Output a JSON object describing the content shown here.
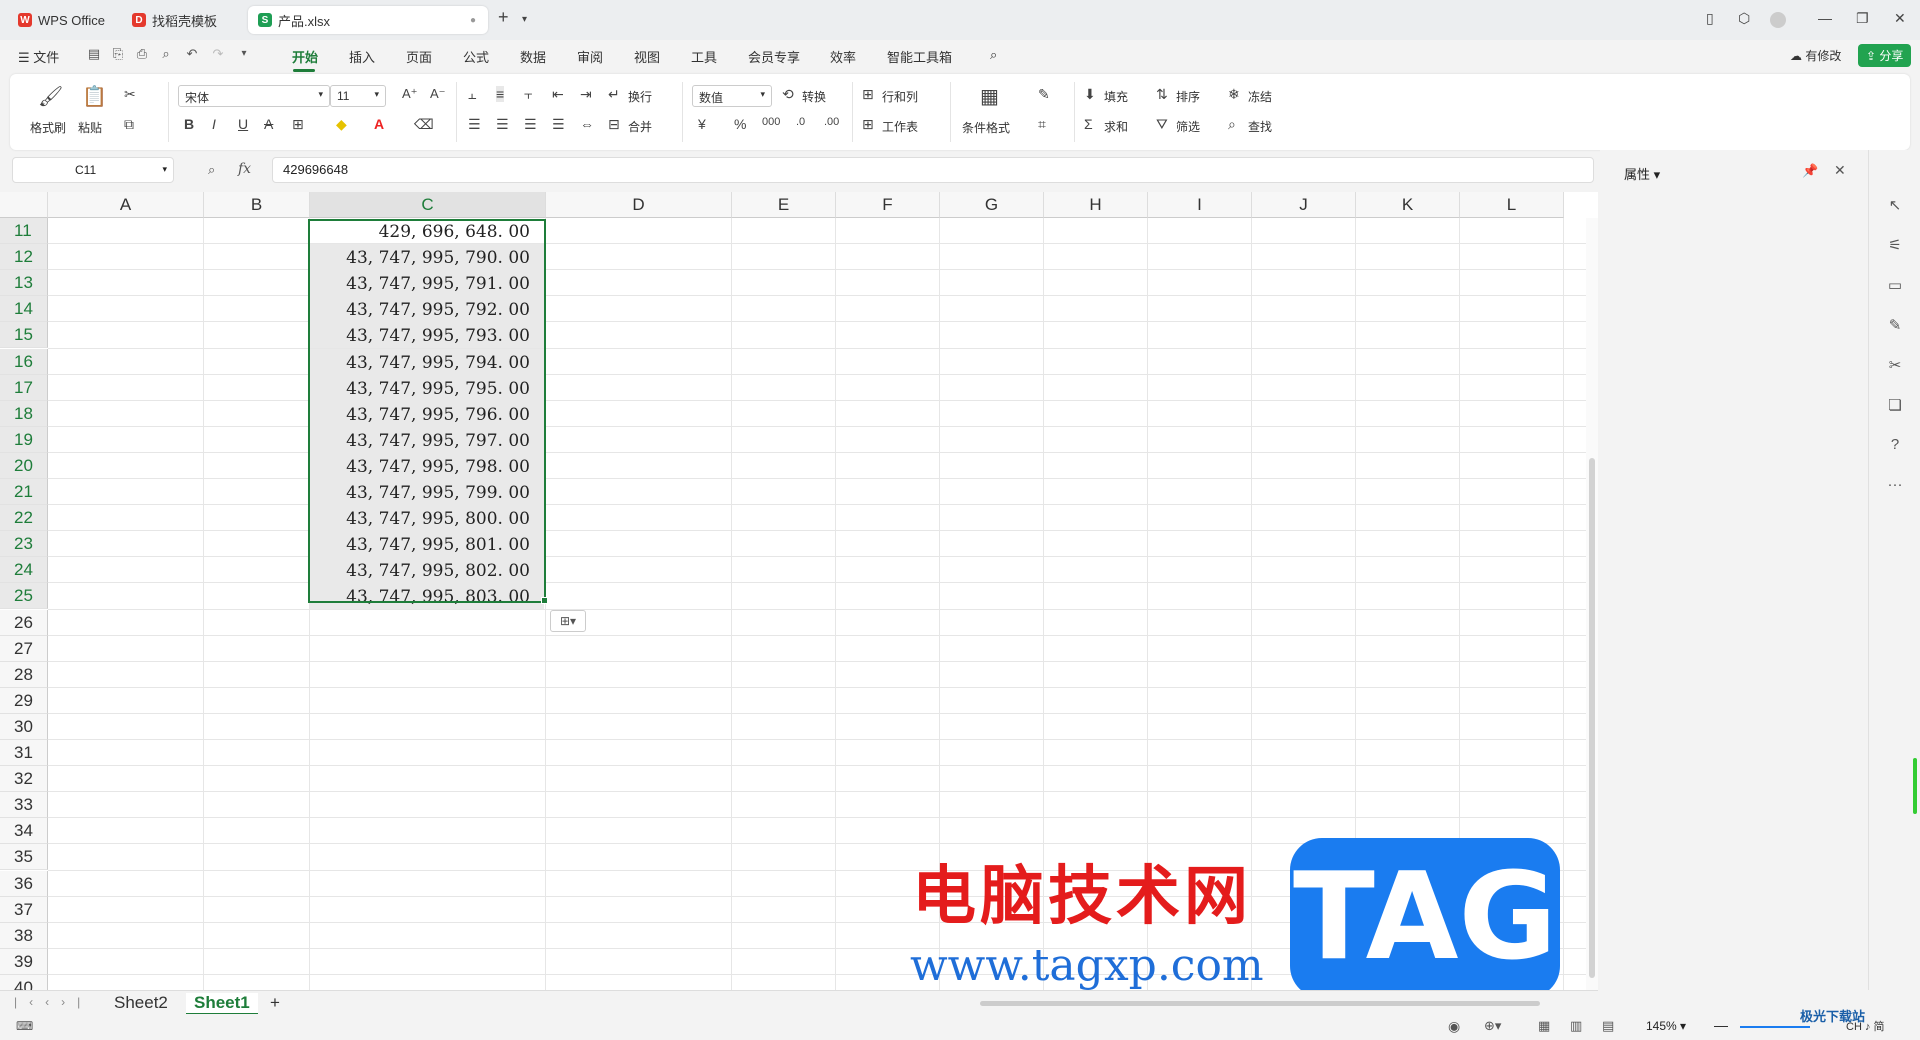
{
  "titlebar": {
    "tabs": [
      {
        "label": "WPS Office",
        "icon": "wps-logo-icon",
        "color": "#e4392d"
      },
      {
        "label": "找稻壳模板",
        "icon": "docer-icon",
        "color": "#e4392d"
      },
      {
        "label": "产品.xlsx",
        "icon": "spreadsheet-icon",
        "color": "#1e9e54"
      }
    ]
  },
  "menu": {
    "file": "文件",
    "items": [
      "开始",
      "插入",
      "页面",
      "公式",
      "数据",
      "审阅",
      "视图",
      "工具",
      "会员专享",
      "效率",
      "智能工具箱"
    ],
    "active": "开始",
    "has_changes": "有修改",
    "share": "分享"
  },
  "ribbon": {
    "format_painter": "格式刷",
    "paste": "粘贴",
    "font_name": "宋体",
    "font_size": "11",
    "wrap": "换行",
    "merge": "合并",
    "number_format": "数值",
    "convert": "转换",
    "row_col": "行和列",
    "worksheet": "工作表",
    "cond_format": "条件格式",
    "fill": "填充",
    "sort": "排序",
    "freeze": "冻结",
    "sum": "求和",
    "filter": "筛选",
    "find": "查找"
  },
  "formula_bar": {
    "name_box": "C11",
    "fx": "fx",
    "value": "429696648"
  },
  "grid": {
    "columns": [
      "A",
      "B",
      "C",
      "D",
      "E",
      "F",
      "G",
      "H",
      "I",
      "J",
      "K",
      "L"
    ],
    "active_column": "C",
    "rows": [
      "11",
      "12",
      "13",
      "14",
      "15",
      "16",
      "17",
      "18",
      "19",
      "20",
      "21",
      "22",
      "23",
      "24",
      "25",
      "26",
      "27",
      "28",
      "29",
      "30",
      "31",
      "32",
      "33",
      "34",
      "35",
      "36",
      "37",
      "38",
      "39",
      "40"
    ],
    "c_values": [
      "429, 696, 648. 00",
      "43, 747, 995, 790. 00",
      "43, 747, 995, 791. 00",
      "43, 747, 995, 792. 00",
      "43, 747, 995, 793. 00",
      "43, 747, 995, 794. 00",
      "43, 747, 995, 795. 00",
      "43, 747, 995, 796. 00",
      "43, 747, 995, 797. 00",
      "43, 747, 995, 798. 00",
      "43, 747, 995, 799. 00",
      "43, 747, 995, 800. 00",
      "43, 747, 995, 801. 00",
      "43, 747, 995, 802. 00",
      "43, 747, 995, 803. 00"
    ]
  },
  "side_panel": {
    "title": "属性"
  },
  "sheets": {
    "tabs": [
      "Sheet2",
      "Sheet1"
    ],
    "active": "Sheet1",
    "add": "+"
  },
  "status": {
    "zoom": "145%",
    "ime": "CH ♪ 简"
  },
  "watermark": {
    "text": "电脑技术网",
    "url": "www.tagxp.com",
    "tag": "TAG",
    "corner": "极光下载站"
  },
  "colors": {
    "accent": "#1e7d3a",
    "share_bg": "#22a350",
    "watermark_red": "#e41c1c",
    "watermark_blue": "#1a7cf0"
  }
}
